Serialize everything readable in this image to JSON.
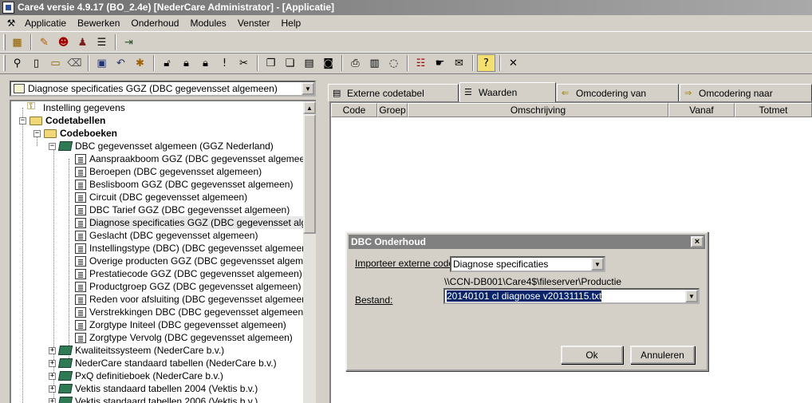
{
  "window": {
    "title": "Care4 versie 4.9.17 (BO_2.4e)  [NederCare Administrator] - [Applicatie]"
  },
  "menu": [
    "Applicatie",
    "Bewerken",
    "Onderhoud",
    "Modules",
    "Venster",
    "Help"
  ],
  "left": {
    "combo_value": "Diagnose specificaties GGZ (DBC gegevensset algemeen)",
    "tree": {
      "instelling": "Instelling gegevens",
      "codetabellen": "Codetabellen",
      "codeboeken": "Codeboeken",
      "dbc_set": "DBC gegevensset algemeen (GGZ Nederland)",
      "dbc_items": [
        "Aanspraakboom GGZ (DBC gegevensset algemeen)",
        "Beroepen (DBC gegevensset algemeen)",
        "Beslisboom GGZ (DBC gegevensset algemeen)",
        "Circuit (DBC gegevensset algemeen)",
        "DBC Tarief GGZ (DBC gegevensset algemeen)",
        "Diagnose specificaties GGZ (DBC gegevensset algemeen)",
        "Geslacht (DBC gegevensset algemeen)",
        "Instellingstype (DBC) (DBC gegevensset algemeen)",
        "Overige producten GGZ (DBC gegevensset algemeen)",
        "Prestatiecode GGZ (DBC gegevensset algemeen)",
        "Productgroep GGZ (DBC gegevensset algemeen)",
        "Reden voor afsluiting (DBC gegevensset algemeen)",
        "Verstrekkingen DBC (DBC gegevensset algemeen)",
        "Zorgtype Initeel (DBC gegevensset algemeen)",
        "Zorgtype Vervolg (DBC gegevensset algemeen)"
      ],
      "other_books": [
        "Kwaliteitssysteem (NederCare b.v.)",
        "NederCare standaard tabellen (NederCare b.v.)",
        "PxQ definitieboek (NederCare b.v.)",
        "Vektis standaard tabellen 2004 (Vektis b.v.)",
        "Vektis standaard tabellen 2006 (Vektis b.v.)"
      ]
    }
  },
  "tabs": [
    "Externe codetabel",
    "Waarden",
    "Omcodering van",
    "Omcodering naar"
  ],
  "grid": {
    "columns": [
      "Code",
      "Groep",
      "Omschrijving",
      "Vanaf",
      "Totmet"
    ]
  },
  "dialog": {
    "title": "DBC Onderhoud",
    "close": "×",
    "import_label": "Importeer externe code:",
    "import_value": "Diagnose specificaties",
    "path": "\\\\CCN-DB001\\Care4$\\fileserver\\Productie",
    "file_label": "Bestand:",
    "file_value": "20140101 cl diagnose v20131115.txt",
    "ok": "Ok",
    "cancel": "Annuleren"
  }
}
